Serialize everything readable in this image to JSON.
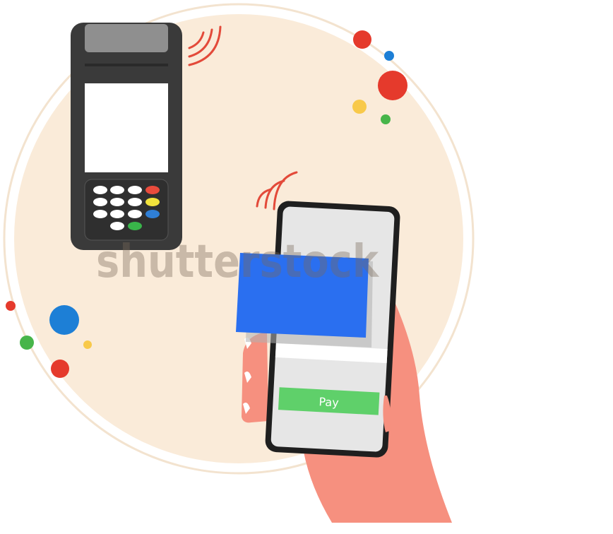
{
  "watermark": {
    "text": "shutterstock"
  },
  "phone": {
    "pay_button_label": "Pay"
  },
  "colors": {
    "background": "#ffffff",
    "circle_fill": "#faebd9",
    "circle_outline": "#f3e3cf",
    "terminal_body": "#3a3a3a",
    "terminal_printer": "#8f8f8f",
    "terminal_screen": "#ffffff",
    "terminal_keypad": "#2f2f2f",
    "key_white": "#ffffff",
    "key_red": "#e94b3c",
    "key_yellow": "#f2e33c",
    "key_blue": "#2f7fd6",
    "key_green": "#39b54a",
    "nfc_waves": "#e34a3a",
    "card": "#2a6ff0",
    "phone_frame": "#1f1f1f",
    "phone_screen": "#e6e6e6",
    "pay_button": "#5fd06a",
    "hand": "#f6907f",
    "dot_red": "#e53a2c",
    "dot_blue": "#1d7fd6",
    "dot_yellow": "#f8c94a",
    "dot_green": "#47b54a"
  },
  "icons": {
    "terminal": "pos-terminal-icon",
    "nfc_terminal": "nfc-waves-icon",
    "nfc_phone": "nfc-waves-icon",
    "card": "credit-card-icon",
    "phone": "smartphone-icon",
    "hand": "hand-icon"
  }
}
